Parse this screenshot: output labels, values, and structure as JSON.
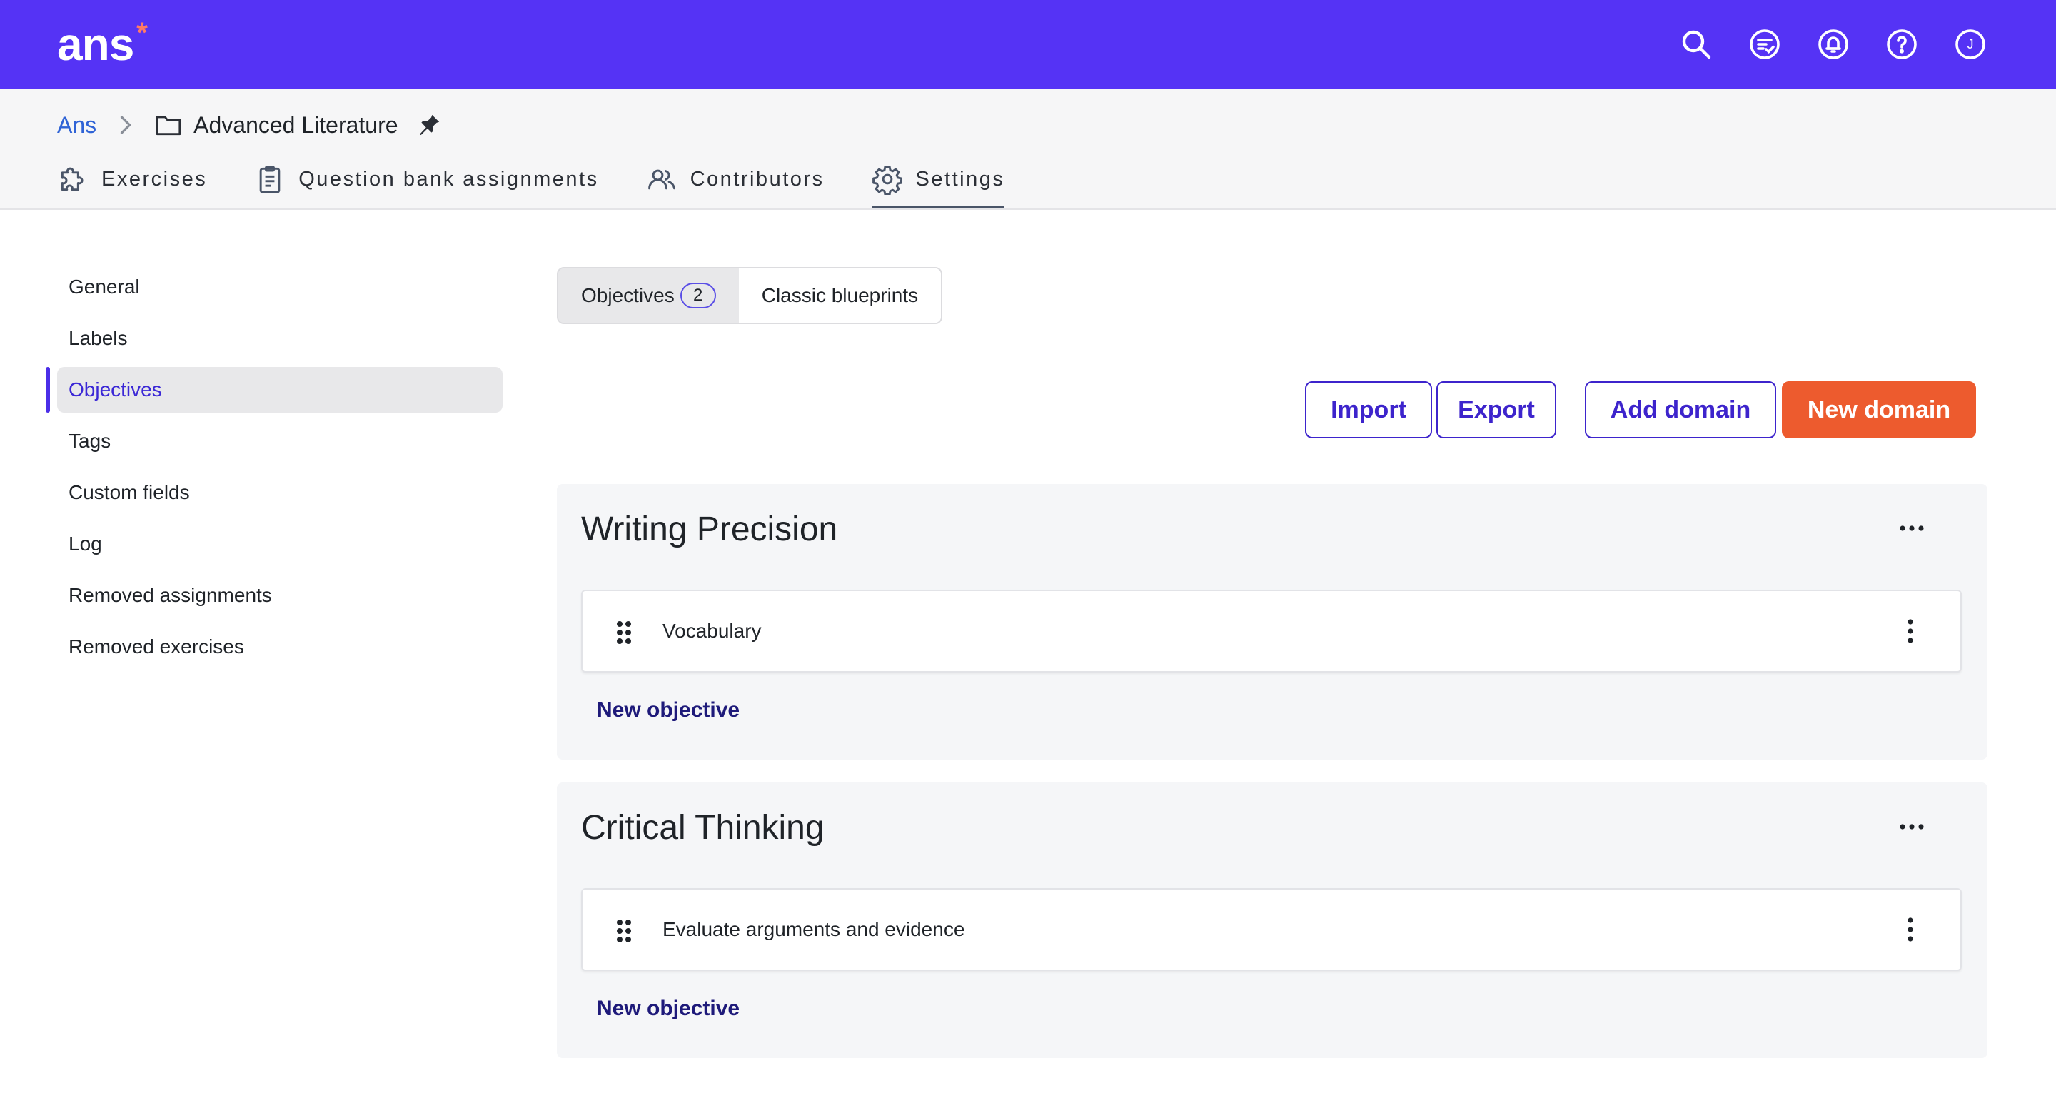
{
  "app": {
    "logo_text": "ans",
    "logo_mark": "*",
    "brand_color": "#5533f5",
    "accent_color": "#ed5b2e"
  },
  "topbar": {
    "icons": [
      "search-icon",
      "review-icon",
      "notifications-icon",
      "help-icon",
      "user-avatar"
    ],
    "avatar_initial": "J"
  },
  "breadcrumb": {
    "root": "Ans",
    "current": "Advanced Literature"
  },
  "tabs": [
    {
      "label": "Exercises",
      "icon": "puzzle-icon"
    },
    {
      "label": "Question bank assignments",
      "icon": "clipboard-icon"
    },
    {
      "label": "Contributors",
      "icon": "users-icon"
    },
    {
      "label": "Settings",
      "icon": "gear-icon",
      "active": true
    }
  ],
  "sidebar": {
    "items": [
      {
        "label": "General"
      },
      {
        "label": "Labels"
      },
      {
        "label": "Objectives",
        "active": true
      },
      {
        "label": "Tags"
      },
      {
        "label": "Custom fields"
      },
      {
        "label": "Log"
      },
      {
        "label": "Removed assignments"
      },
      {
        "label": "Removed exercises"
      }
    ]
  },
  "segment": {
    "objectives_label": "Objectives",
    "objectives_count": "2",
    "blueprints_label": "Classic blueprints"
  },
  "actions": {
    "import": "Import",
    "export": "Export",
    "add_domain": "Add domain",
    "new_domain": "New domain"
  },
  "domains": [
    {
      "title": "Writing Precision",
      "objectives": [
        {
          "label": "Vocabulary"
        }
      ],
      "new_objective": "New objective"
    },
    {
      "title": "Critical Thinking",
      "objectives": [
        {
          "label": "Evaluate arguments and evidence"
        }
      ],
      "new_objective": "New objective"
    }
  ]
}
